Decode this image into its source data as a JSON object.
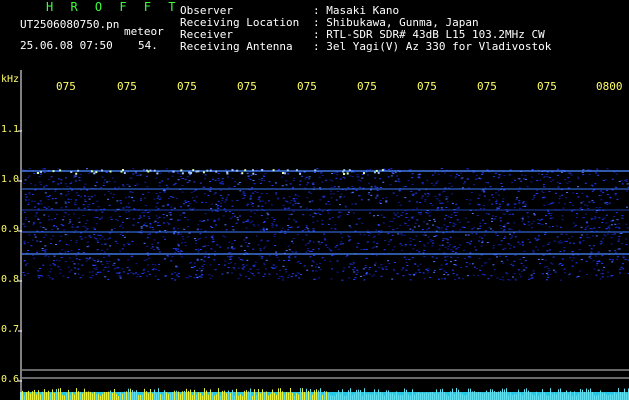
{
  "header": {
    "station": "H R O F F T",
    "filename": "UT2506080750.pn",
    "meteor_label": "meteor",
    "datetime": "25.06.08 07:50",
    "count": "54.",
    "info": [
      {
        "label": "Observer",
        "value": ": Masaki Kano"
      },
      {
        "label": "Receiving Location",
        "value": ": Shibukawa, Gunma, Japan"
      },
      {
        "label": "Receiver",
        "value": ": RTL-SDR SDR# 43dB L15 103.2MHz CW"
      },
      {
        "label": "Receiving Antenna",
        "value": ": 3el Yagi(V) Az 330 for Vladivostok"
      }
    ]
  },
  "time_axis": {
    "ticks": [
      "075",
      "075",
      "075",
      "075",
      "075",
      "075",
      "075",
      "075",
      "075",
      "0800"
    ]
  },
  "freq_axis": {
    "unit": "kHz",
    "ticks": [
      "1.1",
      "1.0",
      "0.9",
      "0.8",
      "0.7",
      "0.6"
    ]
  },
  "colors": {
    "background": "#000000",
    "text": "#ffffff",
    "station": "#3cff3c",
    "axis": "#ffff66",
    "noise": "#1f3fff",
    "bright": "#a0c8ff"
  }
}
